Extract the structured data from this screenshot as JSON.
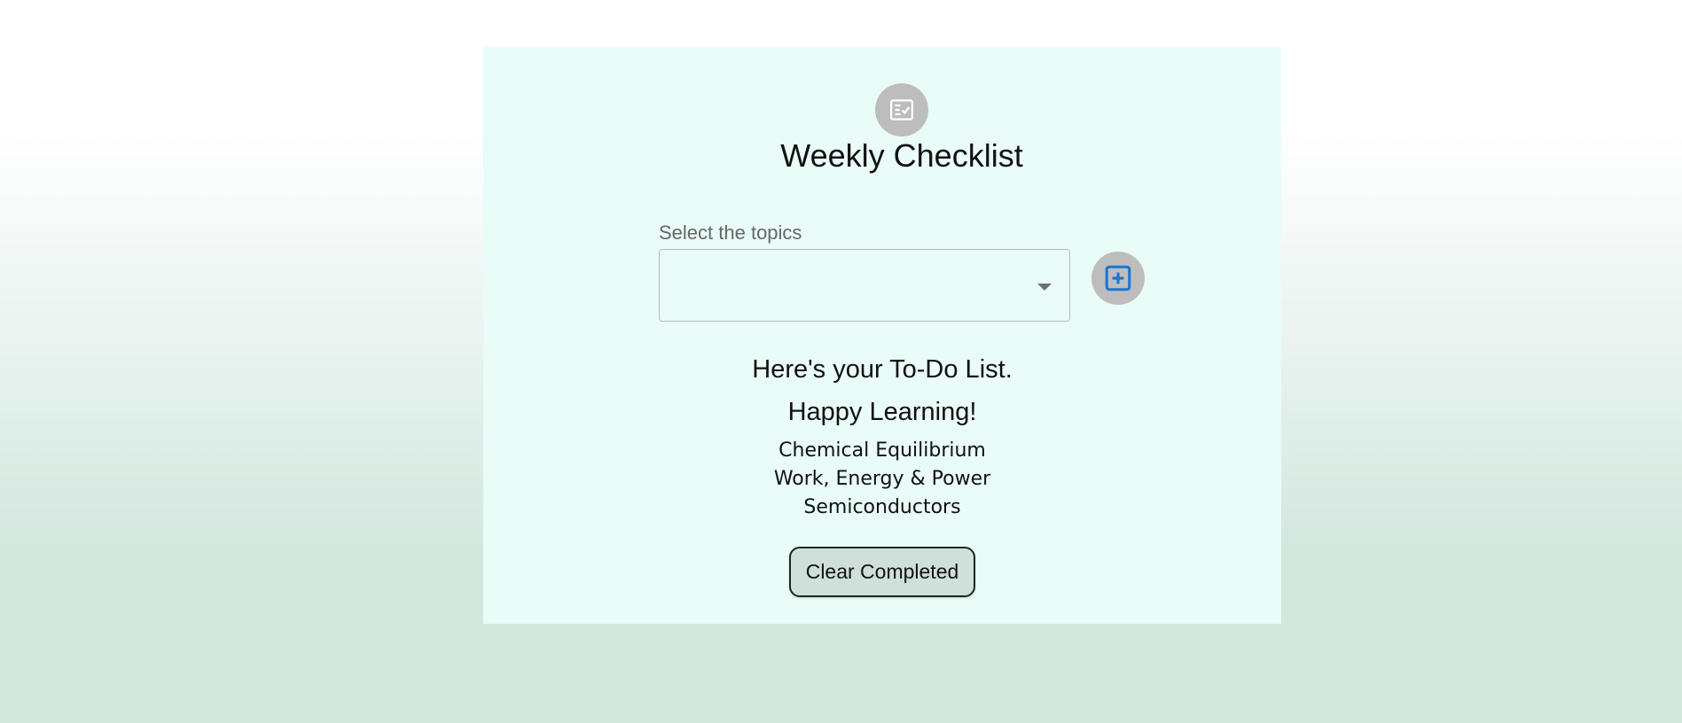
{
  "app": {
    "title": "Weekly Checklist",
    "title_icon": "checklist-icon"
  },
  "topic_select": {
    "label": "Select the topics",
    "value": "",
    "icon": "dropdown-caret-icon"
  },
  "add_button": {
    "icon": "add-box-icon",
    "accent_color": "#1976d2"
  },
  "todo": {
    "heading": "Here's your To-Do List.",
    "subheading": "Happy Learning!",
    "items": [
      "Chemical Equilibrium",
      "Work, Energy & Power",
      "Semiconductors"
    ]
  },
  "clear_button": {
    "label": "Clear Completed"
  },
  "colors": {
    "card_background": "#e9fcf7",
    "page_bottom": "#d3e7df",
    "icon_circle": "#bdbdbd"
  }
}
